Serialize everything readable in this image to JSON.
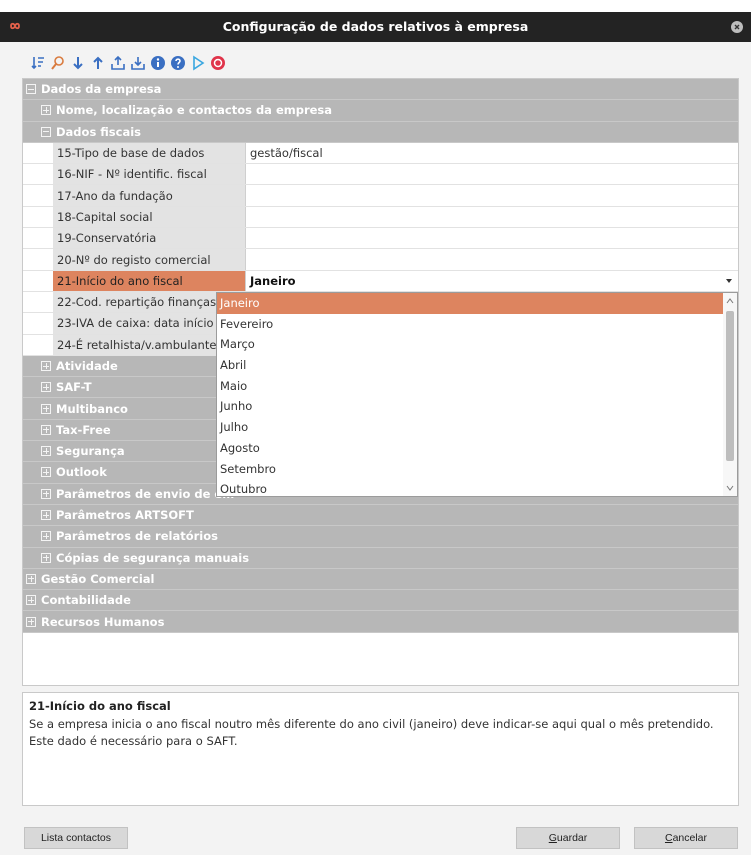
{
  "window": {
    "title": "Configuração de dados relativos à empresa"
  },
  "toolbar": {
    "icons": [
      "sort-icon",
      "search-icon",
      "move-down-icon",
      "move-up-icon",
      "export-icon",
      "import-icon",
      "info-icon",
      "help-icon",
      "play-icon",
      "stop-icon"
    ]
  },
  "tree": {
    "dados_empresa": "Dados da empresa",
    "nome_localizacao": "Nome, localização e contactos da empresa",
    "dados_fiscais": "Dados fiscais",
    "fields": [
      {
        "label": "15-Tipo de base de dados",
        "value": "gestão/fiscal"
      },
      {
        "label": "16-NIF - Nº identific. fiscal",
        "value": ""
      },
      {
        "label": "17-Ano da fundação",
        "value": ""
      },
      {
        "label": "18-Capital social",
        "value": ""
      },
      {
        "label": "19-Conservatória",
        "value": ""
      },
      {
        "label": "20-Nº do registo comercial",
        "value": ""
      },
      {
        "label": "21-Início do ano fiscal",
        "value": "Janeiro"
      },
      {
        "label": "22-Cod. repartição finanças",
        "value": ""
      },
      {
        "label": "23-IVA de caixa: data início",
        "value": ""
      },
      {
        "label": "24-É retalhista/v.ambulante",
        "value": ""
      }
    ],
    "subgroups": [
      "Atividade",
      "SAF-T",
      "Multibanco",
      "Tax-Free",
      "Segurança",
      "Outlook",
      "Parâmetros de envio de em",
      "Parâmetros ARTSOFT",
      "Parâmetros de relatórios",
      "Cópias de segurança manuais"
    ],
    "top_groups": [
      "Gestão Comercial",
      "Contabilidade",
      "Recursos Humanos"
    ]
  },
  "dropdown": {
    "options": [
      "Janeiro",
      "Fevereiro",
      "Março",
      "Abril",
      "Maio",
      "Junho",
      "Julho",
      "Agosto",
      "Setembro",
      "Outubro"
    ],
    "selected": "Janeiro"
  },
  "help": {
    "heading": "21-Início do ano fiscal",
    "text": "Se a empresa inicia o ano fiscal noutro mês diferente do ano civil (janeiro) deve indicar-se aqui qual o mês pretendido. Este dado é necessário para o SAFT."
  },
  "buttons": {
    "lista_contactos": "Lista contactos",
    "guardar_first": "G",
    "guardar_rest": "uardar",
    "cancelar_first": "C",
    "cancelar_rest": "ancelar"
  },
  "colors": {
    "accent": "#dd845f",
    "group_bg": "#b7b7b7",
    "titlebar": "#232323"
  }
}
